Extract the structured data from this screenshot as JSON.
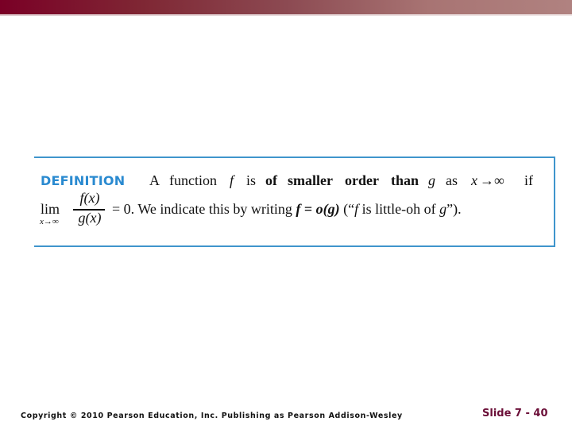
{
  "colors": {
    "header_bar_start": "#7a0026",
    "header_bar_end": "#b08280",
    "definition_label": "#2a8ad0",
    "box_border": "#3f95cc",
    "slide_number": "#6b0f38"
  },
  "definition": {
    "label": "DEFINITION",
    "line1": {
      "w1": "A",
      "w2": "function",
      "w3": "f",
      "w4": "is",
      "w5": "of",
      "w6": "smaller",
      "w7": "order",
      "w8": "than",
      "w9": "g",
      "w10": "as",
      "w11": "x",
      "w12": "→∞",
      "w13": "if"
    },
    "line2": {
      "lim": "lim",
      "lim_sub": "x→∞",
      "numerator": "f(x)",
      "denominator": "g(x)",
      "eq_zero": "= 0. We indicate this by writing ",
      "f_bold": "f",
      "eq": " = ",
      "o_g": "o(g)",
      "quote_open": " (“",
      "f_it": "f",
      "quote_text": " is little-oh of ",
      "g_it": "g",
      "quote_close": "”)."
    }
  },
  "footer": {
    "copyright": "Copyright © 2010 Pearson Education, Inc.  Publishing as Pearson Addison-Wesley",
    "slide_number": "Slide 7 -  40"
  }
}
